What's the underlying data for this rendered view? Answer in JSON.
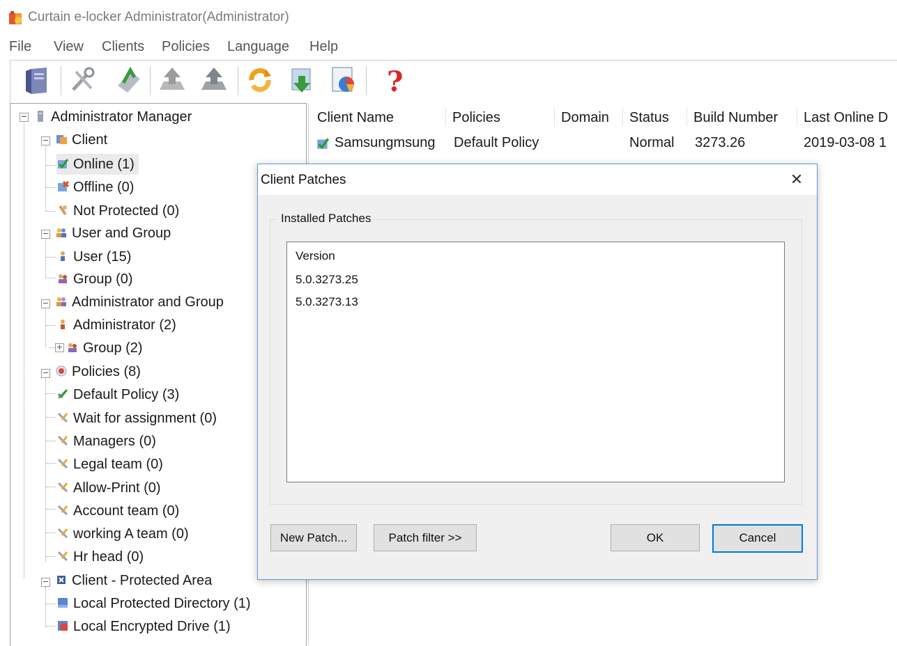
{
  "window": {
    "title": "Curtain e-locker Administrator(Administrator)",
    "app_icon": "curtain-app-icon"
  },
  "menu": [
    "File",
    "View",
    "Clients",
    "Policies",
    "Language",
    "Help"
  ],
  "toolbar": {
    "buttons": [
      "server-icon",
      "tools-icon",
      "deploy-icon",
      "upload-disabled-icon",
      "upload-icon",
      "refresh-icon",
      "download-icon",
      "report-icon",
      "help-icon"
    ]
  },
  "tree": {
    "root": "Administrator Manager",
    "client": "Client",
    "online": "Online (1)",
    "offline": "Offline (0)",
    "not_protected": "Not Protected (0)",
    "user_and_group": "User and Group",
    "user": "User (15)",
    "user_group": "Group (0)",
    "admin_and_group": "Administrator and Group",
    "administrator": "Administrator (2)",
    "admin_group": "Group (2)",
    "policies": "Policies (8)",
    "policy_items": [
      "Default Policy (3)",
      "Wait for assignment (0)",
      "Managers (0)",
      "Legal team (0)",
      "Allow-Print (0)",
      "Account team (0)",
      "working A team (0)",
      "Hr head (0)"
    ],
    "protected_area": "Client - Protected Area",
    "local_dir": "Local Protected Directory  (1)",
    "local_drive": "Local Encrypted Drive (1)"
  },
  "clients_table": {
    "columns": [
      "Client Name",
      "Policies",
      "Domain",
      "Status",
      "Build Number",
      "Last Online D"
    ],
    "rows": [
      {
        "name": "Samsungmsung",
        "policy": "Default Policy",
        "domain": "",
        "status": "Normal",
        "build": "3273.26",
        "last_online": "2019-03-08 1"
      }
    ]
  },
  "dialog": {
    "title": "Client Patches",
    "close": "✕",
    "group_label": "Installed Patches",
    "list_header": "Version",
    "patches": [
      "5.0.3273.25",
      "5.0.3273.13"
    ],
    "buttons": {
      "new_patch": "New Patch...",
      "patch_filter": "Patch filter >>",
      "ok": "OK",
      "cancel": "Cancel"
    }
  },
  "colors": {
    "dialog_border": "#5b9bd5",
    "default_button_border": "#0078d7",
    "help_red": "#d7262b"
  }
}
